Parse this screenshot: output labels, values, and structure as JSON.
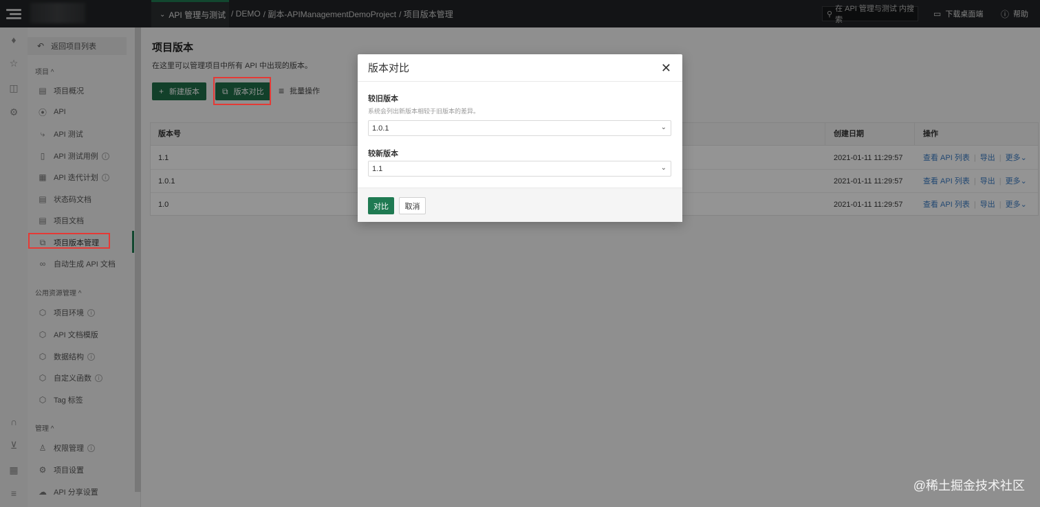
{
  "topbar": {
    "module_label": "API 管理与测试",
    "module_chevron_icon": "chevron-down-icon",
    "breadcrumbs": [
      "/ DEMO",
      "/ 副本-APIManagementDemoProject",
      "/ 项目版本管理"
    ],
    "search_placeholder": "在 API 管理与测试 内搜索",
    "download_label": "下载桌面端",
    "help_label": "帮助"
  },
  "rail_icons": [
    "bell-icon",
    "star-icon",
    "shirt-icon",
    "gear-icon",
    "headset-icon",
    "inbox-icon",
    "keyboard-icon",
    "menu-icon"
  ],
  "sidebar": {
    "back_label": "返回项目列表",
    "sections": [
      {
        "title": "项目 ^",
        "items": [
          {
            "label": "项目概况",
            "icon": "list-icon",
            "info": false
          },
          {
            "label": "API",
            "icon": "link-icon",
            "info": false
          },
          {
            "label": "API 测试",
            "icon": "lightning-icon",
            "info": false
          },
          {
            "label": "API 测试用例",
            "icon": "file-icon",
            "info": true
          },
          {
            "label": "API 迭代计划",
            "icon": "calendar-icon",
            "info": true
          },
          {
            "label": "状态码文档",
            "icon": "doc-icon",
            "info": false
          },
          {
            "label": "项目文档",
            "icon": "book-icon",
            "info": false
          },
          {
            "label": "项目版本管理",
            "icon": "copy-icon",
            "info": false
          },
          {
            "label": "自动生成 API 文档",
            "icon": "generate-icon",
            "info": false
          }
        ]
      },
      {
        "title": "公用资源管理 ^",
        "items": [
          {
            "label": "项目环境",
            "icon": "cube-icon",
            "info": true
          },
          {
            "label": "API 文档模版",
            "icon": "cube-icon",
            "info": false
          },
          {
            "label": "数据结构",
            "icon": "cube-icon",
            "info": true
          },
          {
            "label": "自定义函数",
            "icon": "cube-icon",
            "info": true
          },
          {
            "label": "Tag 标签",
            "icon": "cube-icon",
            "info": false
          }
        ]
      },
      {
        "title": "管理 ^",
        "items": [
          {
            "label": "权限管理",
            "icon": "user-icon",
            "info": true
          },
          {
            "label": "项目设置",
            "icon": "gear-icon",
            "info": false
          },
          {
            "label": "API 分享设置",
            "icon": "cloud-icon",
            "info": false
          }
        ]
      }
    ]
  },
  "main": {
    "title": "项目版本",
    "description": "在这里可以管理项目中所有 API 中出现的版本。",
    "new_version_label": "新建版本",
    "compare_label": "版本对比",
    "batch_label": "批量操作",
    "table": {
      "columns": [
        "版本号",
        "创建日期",
        "操作"
      ],
      "rows": [
        {
          "version": "1.1",
          "date": "2021-01-11 11:29:57"
        },
        {
          "version": "1.0.1",
          "date": "2021-01-11 11:29:57"
        },
        {
          "version": "1.0",
          "date": "2021-01-11 11:29:57"
        }
      ],
      "actions": {
        "view": "查看 API 列表",
        "export": "导出",
        "more": "更多"
      }
    }
  },
  "modal": {
    "title": "版本对比",
    "old_label": "较旧版本",
    "help_text": "系统会列出新版本相较于旧版本的差异。",
    "old_value": "1.0.1",
    "new_label": "较新版本",
    "new_value": "1.1",
    "ok_label": "对比",
    "cancel_label": "取消"
  },
  "watermark": "@稀土掘金技术社区",
  "colors": {
    "accent": "#1f7a52",
    "topbar": "#222426",
    "highlight": "#e53935",
    "link": "#3b7cc4"
  }
}
